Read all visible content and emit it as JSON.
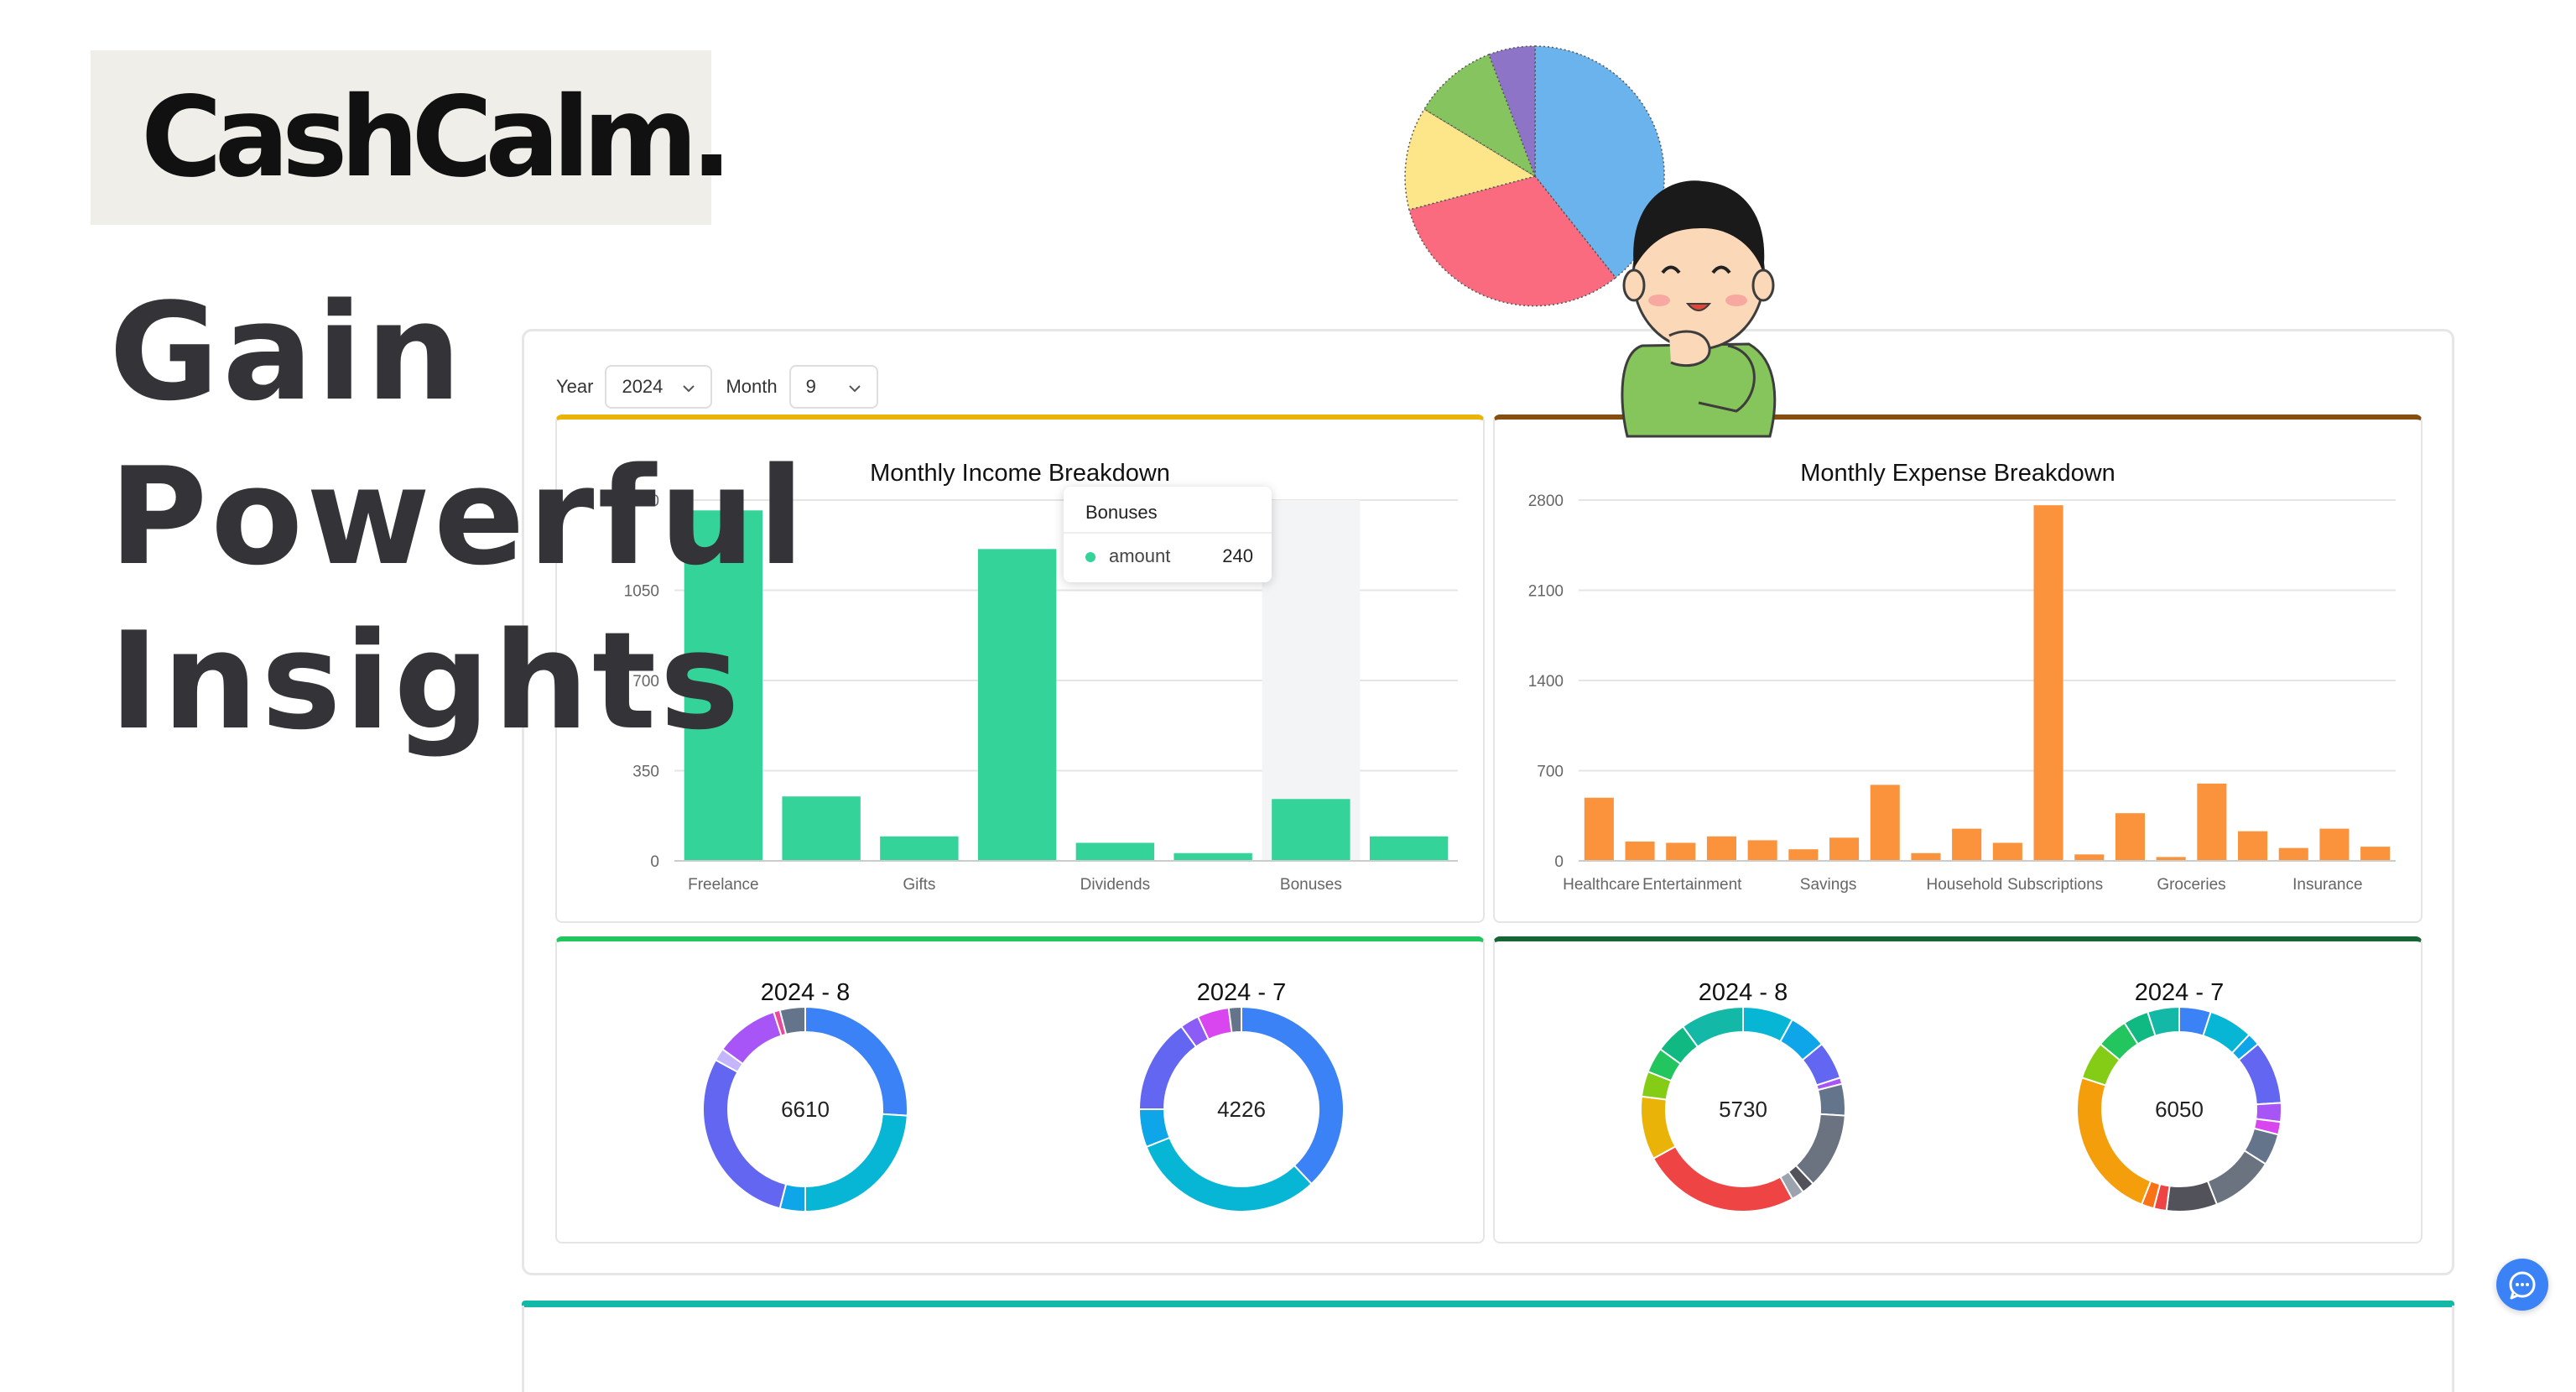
{
  "brand": {
    "logo_text": "CashCalm."
  },
  "headline": {
    "line1": "Gain",
    "line2": "Powerful",
    "line3": "Insights"
  },
  "filters": {
    "year_label": "Year",
    "year_value": "2024",
    "month_label": "Month",
    "month_value": "9"
  },
  "cards": {
    "income_title": "Monthly Income Breakdown",
    "expense_title": "Monthly Expense Breakdown"
  },
  "tooltip": {
    "title": "Bonuses",
    "series": "amount",
    "value": "240"
  },
  "accent_colors": {
    "income_bar": "#34d399",
    "expense_bar": "#fb923c",
    "income_card_border": "#eab308",
    "expense_card_border": "#854d0e",
    "income_donut_card_border": "#22c55e",
    "expense_donut_card_border": "#166534",
    "bottom_card_border": "#14b8a6",
    "chat_button": "#3b82f6"
  },
  "icons": [
    "chevron-down-icon",
    "chat-icon"
  ],
  "chart_data": [
    {
      "type": "bar",
      "title": "Monthly Income Breakdown",
      "categories": [
        "Freelance",
        "",
        "Gifts",
        "",
        "Dividends",
        "",
        "Bonuses",
        ""
      ],
      "values": [
        1360,
        250,
        95,
        1210,
        70,
        30,
        240,
        95
      ],
      "yticks": [
        "0",
        "350",
        "700",
        "1050",
        "1400"
      ],
      "ylim": [
        0,
        1400
      ],
      "grid": true
    },
    {
      "type": "bar",
      "title": "Monthly Expense Breakdown",
      "categories": [
        "Healthcare",
        "",
        "Entertainment",
        "",
        "",
        "Savings",
        "",
        "",
        "Household",
        "",
        "Subscriptions",
        "",
        "",
        "Groceries",
        "",
        "",
        "Insurance",
        ""
      ],
      "values": [
        490,
        150,
        140,
        190,
        160,
        90,
        180,
        590,
        60,
        250,
        140,
        2760,
        50,
        370,
        30,
        600,
        230,
        100,
        250,
        110
      ],
      "yticks": [
        "0",
        "700",
        "1400",
        "2100",
        "2800"
      ],
      "ylim": [
        0,
        2800
      ],
      "grid": true
    },
    {
      "type": "pie",
      "title": "2024 - 8",
      "center_value": "6610",
      "slices": [
        {
          "value": 26,
          "color": "#3b82f6"
        },
        {
          "value": 24,
          "color": "#06b6d4"
        },
        {
          "value": 4,
          "color": "#0ea5e9"
        },
        {
          "value": 29,
          "color": "#6366f1"
        },
        {
          "value": 2,
          "color": "#c4b5fd"
        },
        {
          "value": 10,
          "color": "#a855f7"
        },
        {
          "value": 1,
          "color": "#ec4899"
        },
        {
          "value": 4,
          "color": "#64748b"
        }
      ]
    },
    {
      "type": "pie",
      "title": "2024 - 7",
      "center_value": "4226",
      "slices": [
        {
          "value": 38,
          "color": "#3b82f6"
        },
        {
          "value": 31,
          "color": "#06b6d4"
        },
        {
          "value": 6,
          "color": "#0ea5e9"
        },
        {
          "value": 15,
          "color": "#6366f1"
        },
        {
          "value": 3,
          "color": "#8b5cf6"
        },
        {
          "value": 5,
          "color": "#d946ef"
        },
        {
          "value": 2,
          "color": "#64748b"
        }
      ]
    },
    {
      "type": "pie",
      "title": "2024 - 8",
      "center_value": "5730",
      "slices": [
        {
          "value": 8,
          "color": "#06b6d4"
        },
        {
          "value": 6,
          "color": "#0ea5e9"
        },
        {
          "value": 6,
          "color": "#6366f1"
        },
        {
          "value": 1,
          "color": "#a855f7"
        },
        {
          "value": 5,
          "color": "#64748b"
        },
        {
          "value": 12,
          "color": "#6b7280"
        },
        {
          "value": 2,
          "color": "#52525b"
        },
        {
          "value": 2,
          "color": "#9ca3af"
        },
        {
          "value": 25,
          "color": "#ef4444"
        },
        {
          "value": 10,
          "color": "#eab308"
        },
        {
          "value": 4,
          "color": "#84cc16"
        },
        {
          "value": 4,
          "color": "#22c55e"
        },
        {
          "value": 5,
          "color": "#10b981"
        },
        {
          "value": 10,
          "color": "#14b8a6"
        }
      ]
    },
    {
      "type": "pie",
      "title": "2024 - 7",
      "center_value": "6050",
      "slices": [
        {
          "value": 5,
          "color": "#3b82f6"
        },
        {
          "value": 7,
          "color": "#06b6d4"
        },
        {
          "value": 2,
          "color": "#0ea5e9"
        },
        {
          "value": 10,
          "color": "#6366f1"
        },
        {
          "value": 3,
          "color": "#a855f7"
        },
        {
          "value": 2,
          "color": "#d946ef"
        },
        {
          "value": 5,
          "color": "#64748b"
        },
        {
          "value": 10,
          "color": "#6b7280"
        },
        {
          "value": 8,
          "color": "#52525b"
        },
        {
          "value": 2,
          "color": "#ef4444"
        },
        {
          "value": 2,
          "color": "#f97316"
        },
        {
          "value": 24,
          "color": "#f59e0b"
        },
        {
          "value": 6,
          "color": "#84cc16"
        },
        {
          "value": 5,
          "color": "#22c55e"
        },
        {
          "value": 4,
          "color": "#10b981"
        },
        {
          "value": 5,
          "color": "#14b8a6"
        }
      ]
    }
  ]
}
